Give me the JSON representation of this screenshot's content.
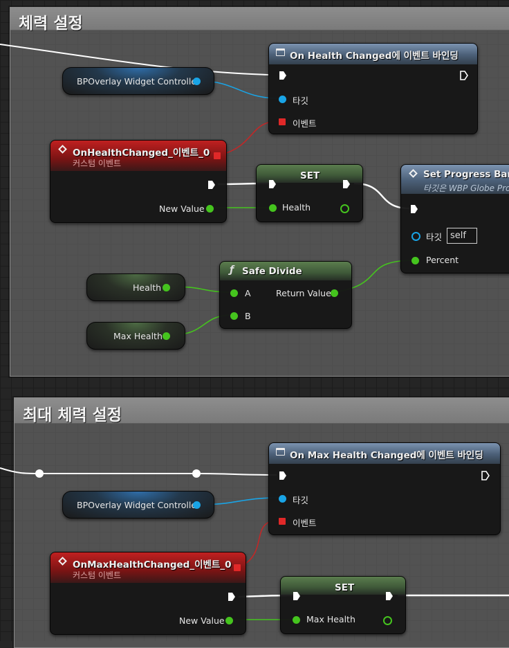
{
  "comments": {
    "health": {
      "title": "체력 설정"
    },
    "max_health": {
      "title": "최대 체력 설정"
    }
  },
  "nodes": {
    "bind_health": {
      "title": "On Health Changed에 이벤트 바인딩",
      "target_label": "타깃",
      "event_label": "이벤트"
    },
    "bp_overlay_1": {
      "label": "BPOverlay Widget Controller"
    },
    "custom_event_health": {
      "title": "OnHealthChanged_이벤트_0",
      "subtitle": "커스텀 이벤트",
      "pin_new_value": "New Value"
    },
    "set_health": {
      "title": "SET",
      "pin_health": "Health"
    },
    "set_progress": {
      "title": "Set Progress Bar P",
      "subtitle": "타깃은 WBP Globe Pro",
      "target_label": "타깃",
      "target_value": "self",
      "percent_label": "Percent"
    },
    "safe_divide": {
      "title": "Safe Divide",
      "pin_a": "A",
      "pin_b": "B",
      "return_value": "Return Value"
    },
    "get_health": {
      "label": "Health"
    },
    "get_max_health": {
      "label": "Max Health"
    },
    "bind_max_health": {
      "title": "On Max Health Changed에 이벤트 바인딩",
      "target_label": "타깃",
      "event_label": "이벤트"
    },
    "bp_overlay_2": {
      "label": "BPOverlay Widget Controller"
    },
    "custom_event_max": {
      "title": "OnMaxHealthChanged_이벤트_0",
      "subtitle": "커스텀 이벤트",
      "pin_new_value": "New Value"
    },
    "set_max_health": {
      "title": "SET",
      "pin_max_health": "Max Health"
    }
  },
  "colors": {
    "exec_wire": "#ffffff",
    "object_wire": "#19a4e6",
    "float_wire": "#45c41e",
    "delegate_wire": "#e02828",
    "event_header": "#a01818",
    "function_header": "#4b5f77",
    "pure_header": "#3e5838"
  }
}
